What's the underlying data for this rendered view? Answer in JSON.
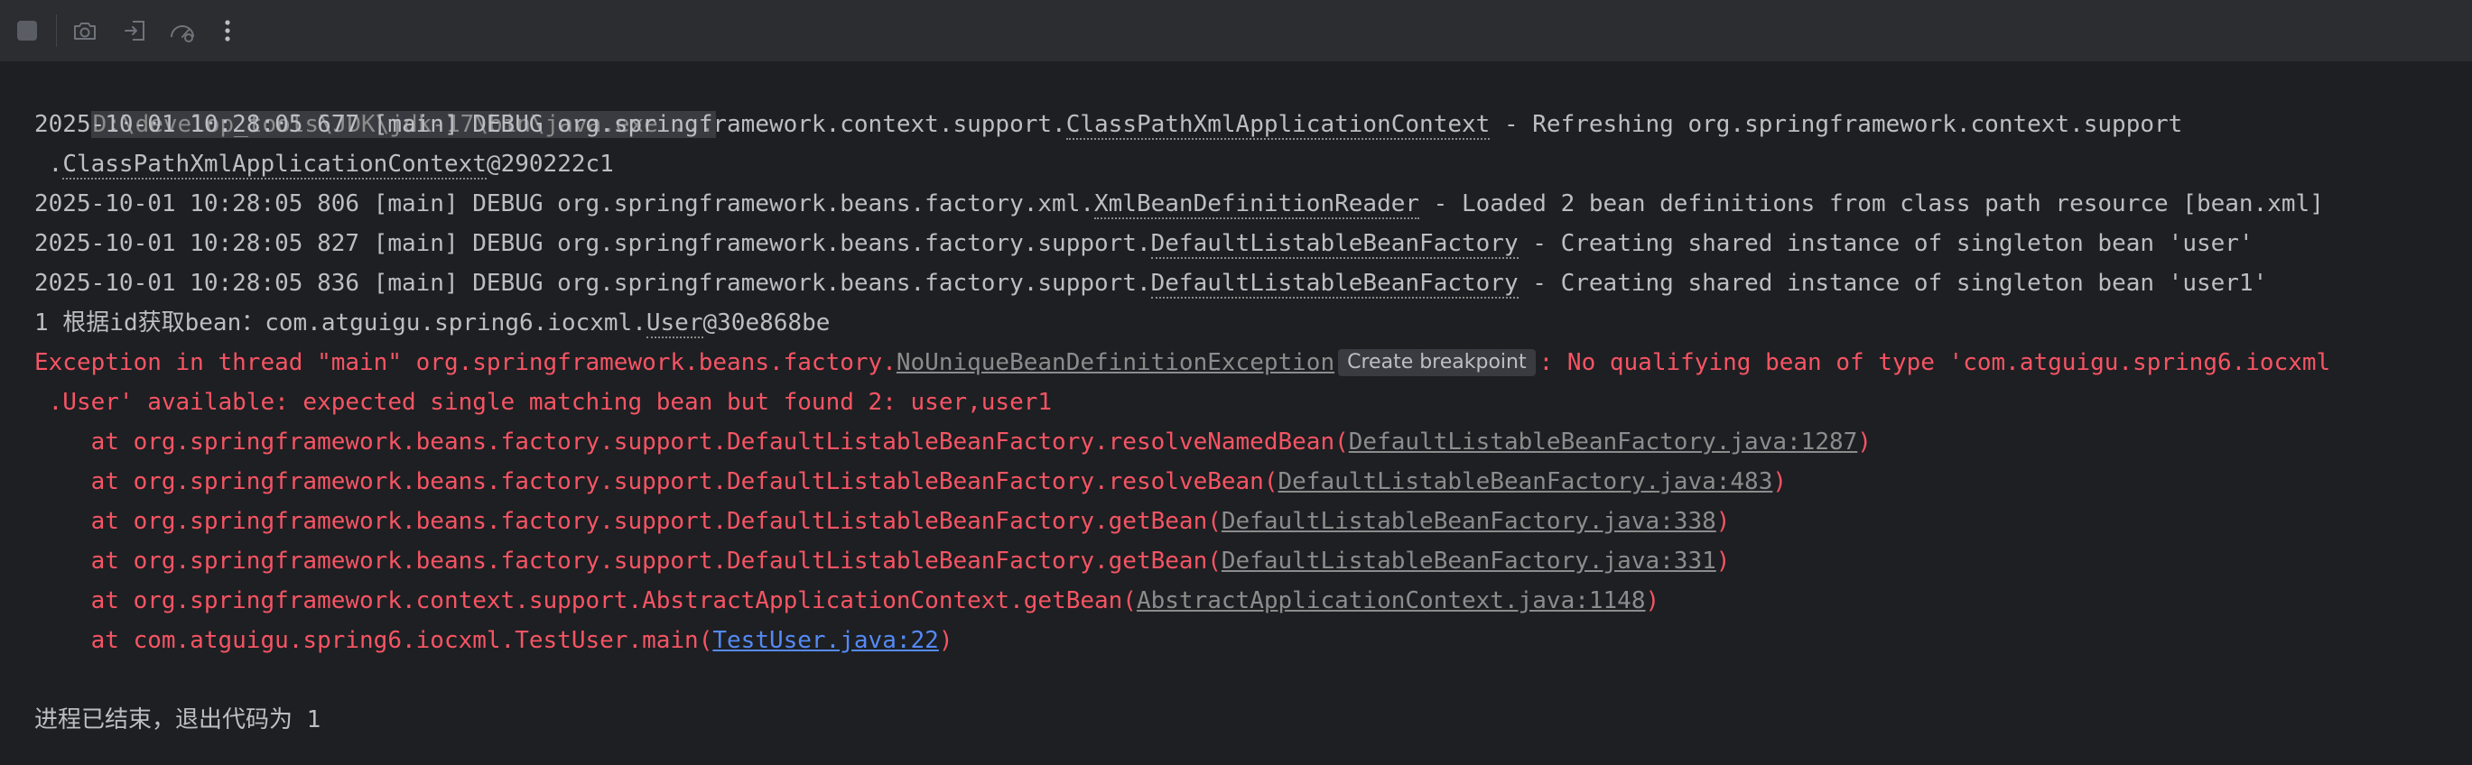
{
  "toolbar": {
    "icons": [
      "stop-icon",
      "camera-icon",
      "restore-layout-icon",
      "profiler-icon",
      "more-options-icon"
    ]
  },
  "console": {
    "command": "D:\\develop_tools\\JDK\\jdk-17\\bin\\java.exe ...",
    "log1": {
      "prefix": "2025-10-01 10:28:05 677 [main] DEBUG org.springframework.context.support.",
      "cls": "ClassPathXmlApplicationContext",
      "suffix": " - Refreshing org.springframework.context.support",
      "cont_dot": ".",
      "cont_cls": "ClassPathXmlApplicationContext",
      "cont_suffix": "@290222c1"
    },
    "log2": {
      "prefix": "2025-10-01 10:28:05 806 [main] DEBUG org.springframework.beans.factory.xml.",
      "cls": "XmlBeanDefinitionReader",
      "suffix": " - Loaded 2 bean definitions from class path resource [bean.xml]"
    },
    "log3": {
      "prefix": "2025-10-01 10:28:05 827 [main] DEBUG org.springframework.beans.factory.support.",
      "cls": "DefaultListableBeanFactory",
      "suffix": " - Creating shared instance of singleton bean 'user'"
    },
    "log4": {
      "prefix": "2025-10-01 10:28:05 836 [main] DEBUG org.springframework.beans.factory.support.",
      "cls": "DefaultListableBeanFactory",
      "suffix": " - Creating shared instance of singleton bean 'user1'"
    },
    "output1": {
      "prefix": "1 根据id获取bean：com.atguigu.spring6.iocxml.",
      "cls": "User",
      "suffix": "@30e868be"
    },
    "exception": {
      "prefix": "Exception in thread \"main\" org.springframework.beans.factory.",
      "cls": "NoUniqueBeanDefinitionException",
      "badge": "Create breakpoint",
      "suffix": ": No qualifying bean of type 'com.atguigu.spring6.iocxml",
      "cont": " .User' available: expected single matching bean but found 2: user,user1"
    },
    "stack": [
      {
        "pre": "    at org.springframework.beans.factory.support.DefaultListableBeanFactory.resolveNamedBean(",
        "link": "DefaultListableBeanFactory.java:1287",
        "post": ")"
      },
      {
        "pre": "    at org.springframework.beans.factory.support.DefaultListableBeanFactory.resolveBean(",
        "link": "DefaultListableBeanFactory.java:483",
        "post": ")"
      },
      {
        "pre": "    at org.springframework.beans.factory.support.DefaultListableBeanFactory.getBean(",
        "link": "DefaultListableBeanFactory.java:338",
        "post": ")"
      },
      {
        "pre": "    at org.springframework.beans.factory.support.DefaultListableBeanFactory.getBean(",
        "link": "DefaultListableBeanFactory.java:331",
        "post": ")"
      },
      {
        "pre": "    at org.springframework.context.support.AbstractApplicationContext.getBean(",
        "link": "AbstractApplicationContext.java:1148",
        "post": ")"
      },
      {
        "pre": "    at com.atguigu.spring6.iocxml.TestUser.main(",
        "link": "TestUser.java:22",
        "post": ")"
      }
    ],
    "exit_message": "进程已结束，退出代码为 1"
  },
  "colors": {
    "background": "#1e1f22",
    "toolbar": "#2b2d30",
    "text": "#bcbec4",
    "error": "#f75464",
    "link_gray": "#8c8c8c",
    "link_blue": "#548af7"
  }
}
